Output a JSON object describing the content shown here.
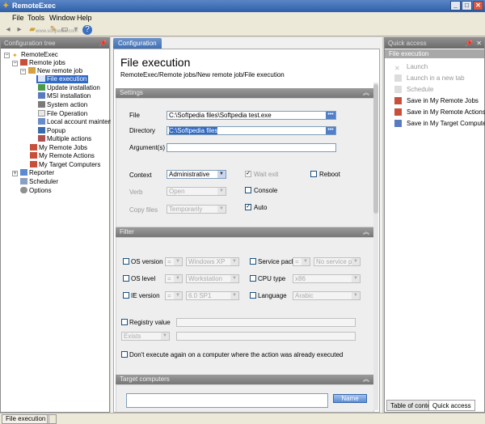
{
  "window": {
    "title": "RemoteExec"
  },
  "menu": [
    "File",
    "Tools",
    "Window",
    "Help"
  ],
  "watermark": "www.softpedia.com",
  "left_pane": {
    "title": "Configuration tree",
    "tree": [
      {
        "label": "RemoteExec",
        "depth": 0
      },
      {
        "label": "Remote jobs",
        "depth": 1
      },
      {
        "label": "New remote job",
        "depth": 2
      },
      {
        "label": "File execution",
        "depth": 3,
        "selected": true
      },
      {
        "label": "Update installation",
        "depth": 3
      },
      {
        "label": "MSI installation",
        "depth": 3
      },
      {
        "label": "System action",
        "depth": 3
      },
      {
        "label": "File Operation",
        "depth": 3
      },
      {
        "label": "Local account maintena...",
        "depth": 3
      },
      {
        "label": "Popup",
        "depth": 3
      },
      {
        "label": "Multiple actions",
        "depth": 3
      },
      {
        "label": "My Remote Jobs",
        "depth": 2
      },
      {
        "label": "My Remote Actions",
        "depth": 2
      },
      {
        "label": "My Target Computers",
        "depth": 2
      },
      {
        "label": "Reporter",
        "depth": 1
      },
      {
        "label": "Scheduler",
        "depth": 1
      },
      {
        "label": "Options",
        "depth": 1
      }
    ]
  },
  "center": {
    "tab": "Configuration",
    "title": "File execution",
    "breadcrumb": "RemoteExec/Remote jobs/New remote job/File execution",
    "settings": {
      "header": "Settings",
      "file_label": "File",
      "file_value": "C:\\Softpedia files\\Softpedia test.exe",
      "directory_label": "Directory",
      "directory_value": "C:\\Softpedia files",
      "arguments_label": "Argument(s)",
      "arguments_value": "",
      "context_label": "Context",
      "context_value": "Administrative",
      "verb_label": "Verb",
      "verb_value": "Open",
      "copy_label": "Copy files",
      "copy_value": "Temporarily",
      "wait_exit": "Wait exit",
      "reboot": "Reboot",
      "console": "Console",
      "auto": "Auto"
    },
    "filter": {
      "header": "Filter",
      "os_version": "OS version",
      "os_version_op": "=",
      "os_version_value": "Windows XP",
      "os_level": "OS level",
      "os_level_op": "=",
      "os_level_value": "Workstation",
      "ie_version": "IE version",
      "ie_version_op": "=",
      "ie_version_value": "6.0 SP1",
      "service_pack": "Service pack",
      "service_pack_op": "=",
      "service_pack_value": "No service p...",
      "cpu_type": "CPU type",
      "cpu_type_value": "x86",
      "language": "Language",
      "language_value": "Arabic",
      "registry_value": "Registry value",
      "registry_op": "Exists",
      "dont_execute": "Don't execute again on a computer where the action was already executed"
    },
    "target": {
      "header": "Target computers",
      "name_button": "Name"
    }
  },
  "right_pane": {
    "title": "Quick access",
    "section": "File execution",
    "actions": [
      {
        "label": "Launch",
        "enabled": false
      },
      {
        "label": "Launch in a new tab",
        "enabled": false
      },
      {
        "label": "Schedule",
        "enabled": false
      },
      {
        "label": "Save in My Remote Jobs",
        "enabled": true
      },
      {
        "label": "Save in My Remote Actions",
        "enabled": true
      },
      {
        "label": "Save in My Target Computers",
        "enabled": true
      }
    ],
    "tabs": [
      "Table of content",
      "Quick access"
    ]
  },
  "status": {
    "text": "File execution"
  },
  "colors": {
    "accent": "#3169c6",
    "header_gray": "#8e8e8e",
    "title_blue": "#2f5fa8"
  }
}
